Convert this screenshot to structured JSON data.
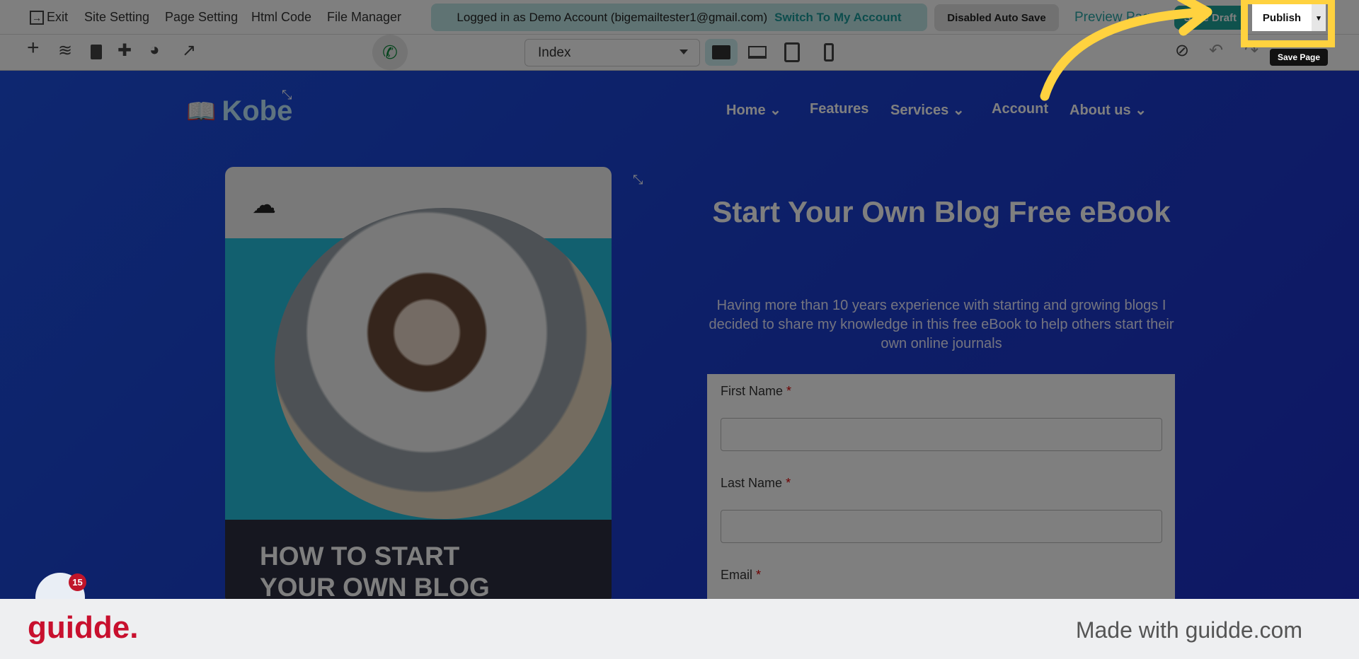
{
  "topbar": {
    "exit": "Exit",
    "site_setting": "Site Setting",
    "page_setting": "Page Setting",
    "html_code": "Html Code",
    "file_manager": "File Manager",
    "logged_in": "Logged in as Demo Account (bigemailtester1@gmail.com)",
    "switch": "Switch To My Account",
    "auto_save": "Disabled Auto Save",
    "preview": "Preview Page",
    "save_draft": "Save Draft",
    "publish": "Publish"
  },
  "toolbar": {
    "page_select": "Index",
    "tooltip": "Save Page"
  },
  "site": {
    "logo": "Kobe",
    "nav": [
      "Home",
      "Features",
      "Services",
      "Account",
      "About us"
    ],
    "card_title_1": "HOW TO START",
    "card_title_2": "YOUR OWN BLOG",
    "heading": "Start Your Own Blog Free eBook",
    "paragraph": "Having more than 10 years experience with starting and growing blogs I decided to share my knowledge in this free eBook to help others start their own online journals",
    "form": {
      "first_name": "First Name",
      "last_name": "Last Name",
      "email": "Email",
      "required": "*"
    }
  },
  "widget": {
    "badge": "15"
  },
  "footer": {
    "logo": "guidde.",
    "made_with": "Made with guidde.com"
  },
  "colors": {
    "highlight": "#ffd23f",
    "accent": "#1ea59b",
    "brand": "#c8102e"
  }
}
